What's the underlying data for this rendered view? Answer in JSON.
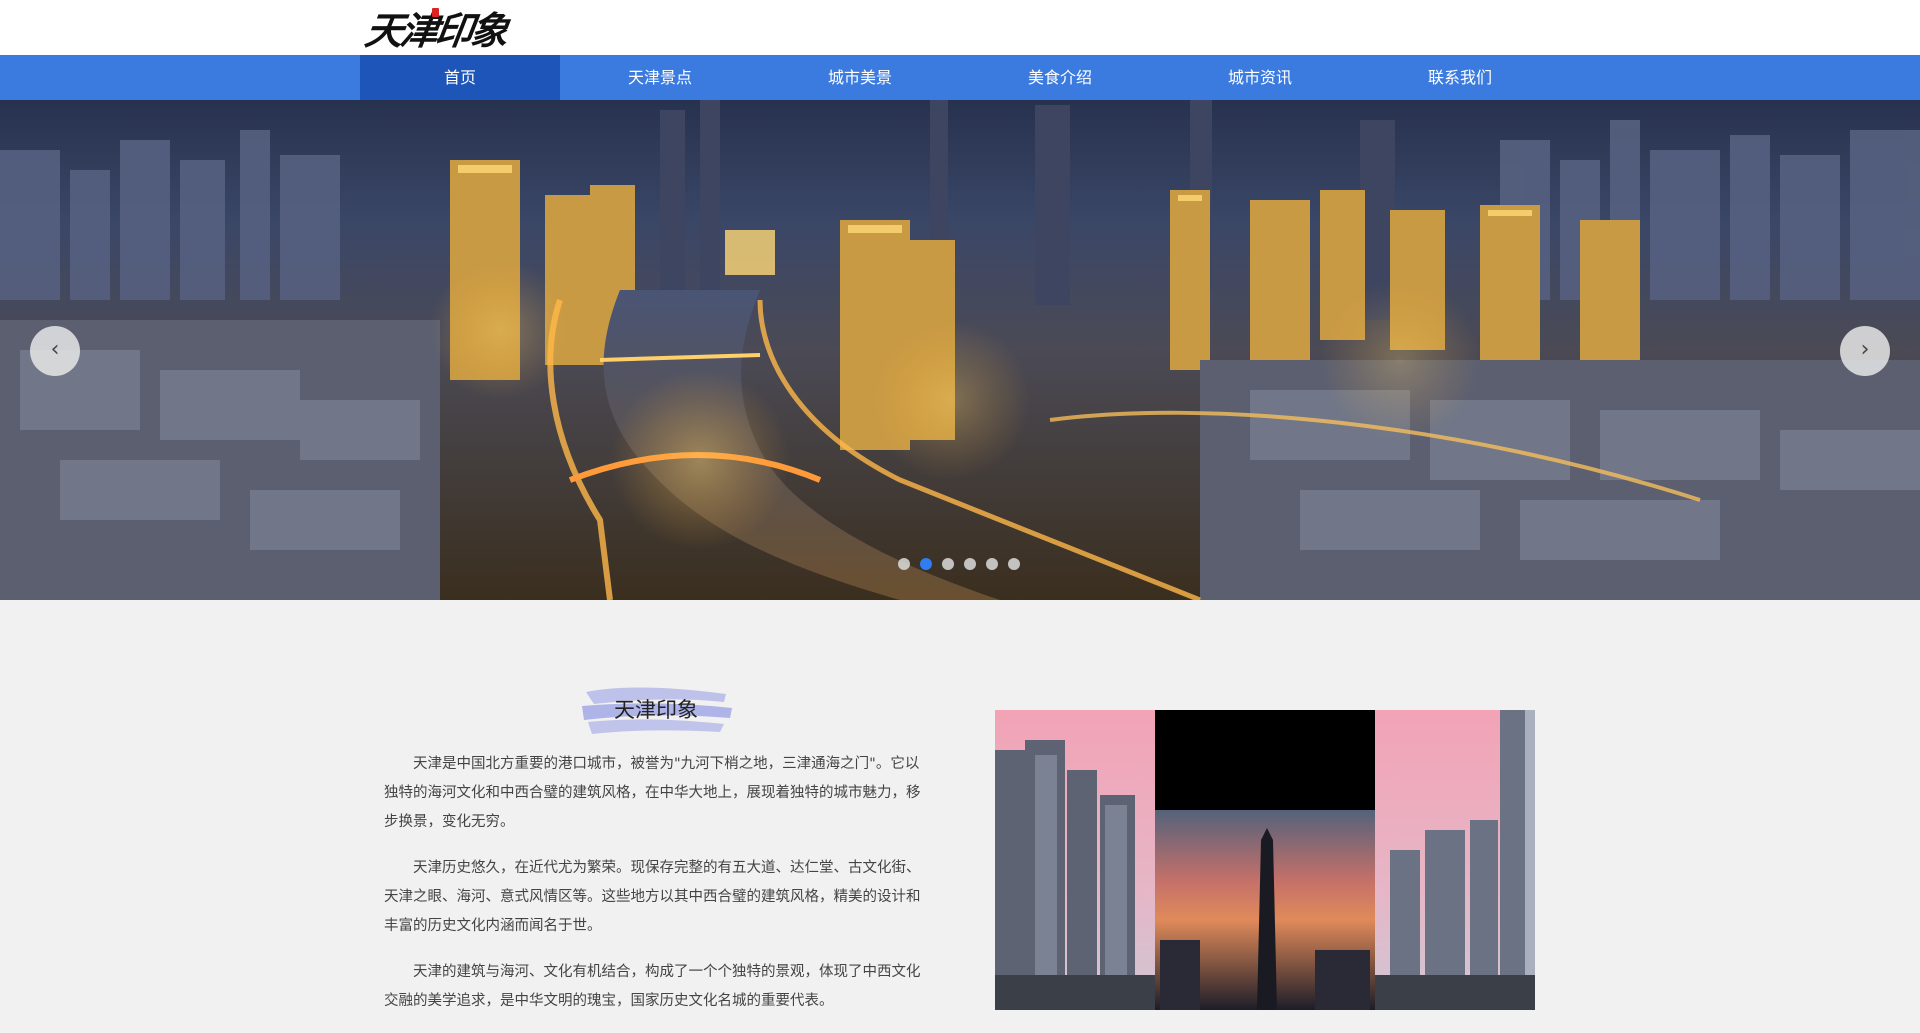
{
  "header": {
    "logo_text": "天津印象"
  },
  "nav": {
    "items": [
      {
        "label": "首页",
        "active": true
      },
      {
        "label": "天津景点",
        "active": false
      },
      {
        "label": "城市美景",
        "active": false
      },
      {
        "label": "美食介绍",
        "active": false
      },
      {
        "label": "城市资讯",
        "active": false
      },
      {
        "label": "联系我们",
        "active": false
      }
    ]
  },
  "banner": {
    "prev_symbol": "‹",
    "next_symbol": "›",
    "slide_count": 6,
    "active_slide": 2
  },
  "intro": {
    "title": "天津印象",
    "paragraphs": [
      "天津是中国北方重要的港口城市，被誉为\"九河下梢之地，三津通海之门\"。它以独特的海河文化和中西合璧的建筑风格，在中华大地上，展现着独特的城市魅力，移步换景，变化无穷。",
      "天津历史悠久，在近代尤为繁荣。现保存完整的有五大道、达仁堂、古文化街、天津之眼、海河、意式风情区等。这些地方以其中西合璧的建筑风格，精美的设计和丰富的历史文化内涵而闻名于世。",
      "天津的建筑与海河、文化有机结合，构成了一个个独特的景观，体现了中西文化交融的美学追求，是中华文明的瑰宝，国家历史文化名城的重要代表。"
    ]
  },
  "colors": {
    "nav_bg": "#3b7be0",
    "nav_active": "#1e55b8",
    "dot_active": "#2f7df0",
    "page_bg": "#f1f1f1"
  }
}
